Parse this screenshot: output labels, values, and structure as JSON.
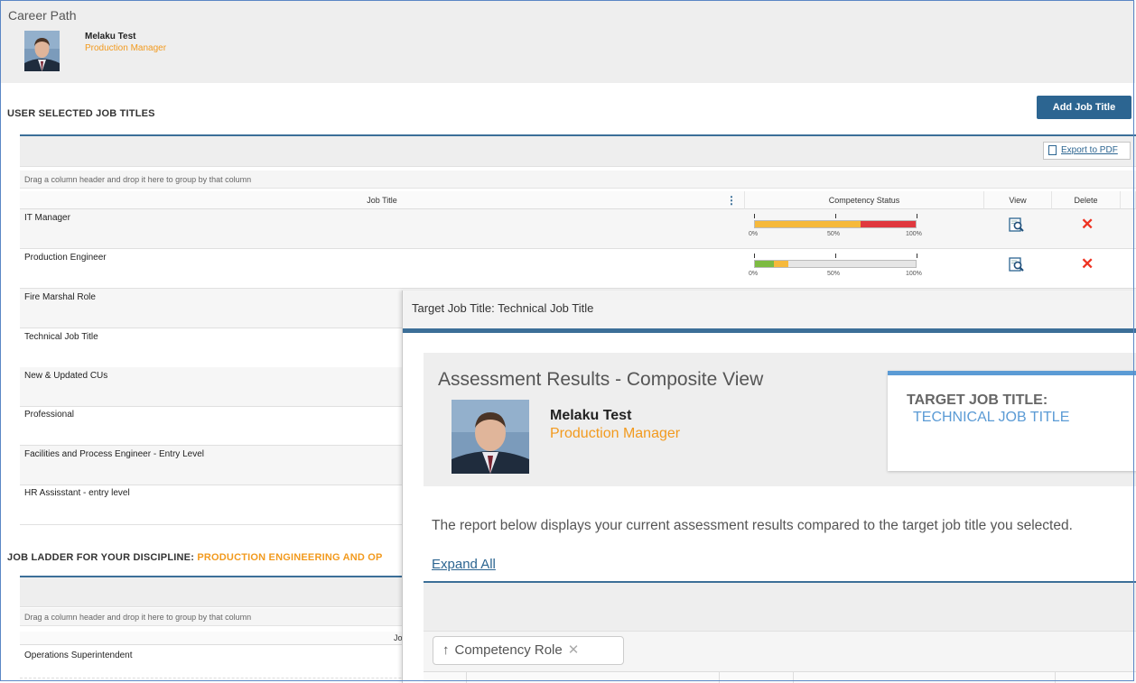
{
  "page": {
    "title": "Career Path"
  },
  "user": {
    "name": "Melaku Test",
    "role": "Production Manager"
  },
  "user_selected": {
    "section_title": "USER SELECTED JOB TITLES",
    "add_button": "Add Job Title",
    "export_button": "Export to PDF",
    "group_hint": "Drag a column header and drop it here to group by that column",
    "columns": {
      "job_title": "Job Title",
      "competency_status": "Competency Status",
      "view": "View",
      "delete": "Delete"
    },
    "bar_labels": [
      "0%",
      "50%",
      "100%"
    ],
    "rows": [
      {
        "title": "IT Manager",
        "segments": [
          {
            "color": "#f6b93b",
            "pct": 0.66
          },
          {
            "color": "#e0383e",
            "pct": 0.34
          }
        ]
      },
      {
        "title": "Production Engineer",
        "segments": [
          {
            "color": "#7dbb42",
            "pct": 0.12
          },
          {
            "color": "#f6b93b",
            "pct": 0.09
          }
        ]
      },
      {
        "title": "Fire Marshal Role"
      },
      {
        "title": "Technical Job Title"
      },
      {
        "title": "New & Updated CUs"
      },
      {
        "title": "Professional"
      },
      {
        "title": "Facilities and Process Engineer - Entry Level"
      },
      {
        "title": "HR Assisstant - entry level"
      }
    ]
  },
  "job_ladder": {
    "title_prefix": "JOB LADDER FOR YOUR DISCIPLINE:",
    "discipline": "PRODUCTION ENGINEERING AND OP",
    "group_hint": "Drag a column header and drop it here to group by that column",
    "column_fragment": "Jo",
    "rows": [
      "Operations Superintendent"
    ]
  },
  "modal": {
    "title": "Target Job Title: Technical Job Title",
    "assessment_title": "Assessment Results - Composite View",
    "target_label": "TARGET JOB TITLE:",
    "target_value": "TECHNICAL JOB TITLE",
    "report_text": "The report below displays your current assessment results compared to the target job title you selected.",
    "expand_all": "Expand All",
    "group_chip": {
      "arrow": "↑",
      "label": "Competency Role",
      "close": "✕"
    }
  }
}
